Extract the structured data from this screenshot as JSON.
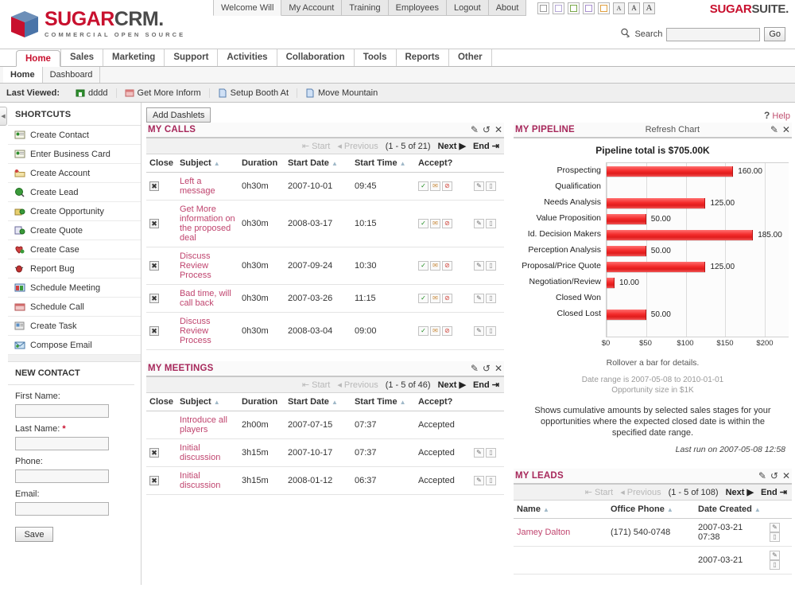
{
  "brand": {
    "name_primary": "SUGAR",
    "name_secondary": "CRM.",
    "tagline": "COMMERCIAL OPEN SOURCE",
    "suite_primary": "SUGAR",
    "suite_secondary": "SUITE.",
    "accent_color": "#c8102e",
    "dashlet_title_color": "#a7285b"
  },
  "utility_nav": [
    {
      "label": "Welcome Will",
      "active": true
    },
    {
      "label": "My Account",
      "active": false
    },
    {
      "label": "Training",
      "active": false
    },
    {
      "label": "Employees",
      "active": false
    },
    {
      "label": "Logout",
      "active": false
    },
    {
      "label": "About",
      "active": false
    }
  ],
  "theme_swatches": [
    {
      "name": "theme-swatch-gray",
      "color": "#9a9a9a"
    },
    {
      "name": "theme-swatch-lavender",
      "color": "#b6a8d8"
    },
    {
      "name": "theme-swatch-green",
      "color": "#7aa84a"
    },
    {
      "name": "theme-swatch-purple",
      "color": "#a98fd0"
    },
    {
      "name": "theme-swatch-orange",
      "color": "#e0a040"
    }
  ],
  "font_sizes": [
    {
      "label": "A",
      "size": "small"
    },
    {
      "label": "A",
      "size": "medium"
    },
    {
      "label": "A",
      "size": "large"
    }
  ],
  "search": {
    "label": "Search",
    "value": "",
    "placeholder": "",
    "button": "Go"
  },
  "module_tabs": [
    {
      "label": "Home",
      "active": true
    },
    {
      "label": "Sales",
      "active": false
    },
    {
      "label": "Marketing",
      "active": false
    },
    {
      "label": "Support",
      "active": false
    },
    {
      "label": "Activities",
      "active": false
    },
    {
      "label": "Collaboration",
      "active": false
    },
    {
      "label": "Tools",
      "active": false
    },
    {
      "label": "Reports",
      "active": false
    },
    {
      "label": "Other",
      "active": false
    }
  ],
  "sub_nav": [
    {
      "label": "Home",
      "active": true
    },
    {
      "label": "Dashboard",
      "active": false
    }
  ],
  "last_viewed": {
    "label": "Last Viewed:",
    "items": [
      {
        "label": "dddd",
        "icon": "account-icon"
      },
      {
        "label": "Get More Inform",
        "icon": "call-icon"
      },
      {
        "label": "Setup Booth At",
        "icon": "task-icon"
      },
      {
        "label": "Move Mountain",
        "icon": "task-icon"
      }
    ]
  },
  "sidebar": {
    "collapse_icon": "collapse-left-icon",
    "shortcuts_title": "SHORTCUTS",
    "shortcuts": [
      {
        "label": "Create Contact",
        "icon": "create-contact-icon"
      },
      {
        "label": "Enter Business Card",
        "icon": "business-card-icon"
      },
      {
        "label": "Create Account",
        "icon": "create-account-icon"
      },
      {
        "label": "Create Lead",
        "icon": "create-lead-icon"
      },
      {
        "label": "Create Opportunity",
        "icon": "create-opportunity-icon"
      },
      {
        "label": "Create Quote",
        "icon": "create-quote-icon"
      },
      {
        "label": "Create Case",
        "icon": "create-case-icon"
      },
      {
        "label": "Report Bug",
        "icon": "report-bug-icon"
      },
      {
        "label": "Schedule Meeting",
        "icon": "schedule-meeting-icon"
      },
      {
        "label": "Schedule Call",
        "icon": "schedule-call-icon"
      },
      {
        "label": "Create Task",
        "icon": "create-task-icon"
      },
      {
        "label": "Compose Email",
        "icon": "compose-email-icon"
      }
    ],
    "new_contact": {
      "title": "NEW CONTACT",
      "fields": [
        {
          "label": "First Name:",
          "value": "",
          "required": false
        },
        {
          "label": "Last Name:",
          "value": "",
          "required": true
        },
        {
          "label": "Phone:",
          "value": "",
          "required": false
        },
        {
          "label": "Email:",
          "value": "",
          "required": false
        }
      ],
      "save_label": "Save"
    }
  },
  "content": {
    "add_dashlets_label": "Add Dashlets",
    "help_label": "Help",
    "help_icon": "question-mark-icon"
  },
  "dashlet_actions": {
    "edit": "edit-pencil-icon",
    "refresh": "refresh-icon",
    "close": "close-x-icon"
  },
  "my_calls": {
    "title": "MY CALLS",
    "pager": {
      "start": "Start",
      "previous": "Previous",
      "count": "(1 - 5 of 21)",
      "next": "Next",
      "end": "End"
    },
    "columns": [
      "Close",
      "Subject",
      "Duration",
      "Start Date",
      "Start Time",
      "Accept?",
      ""
    ],
    "sortable": [
      false,
      true,
      false,
      true,
      true,
      false,
      false
    ],
    "rows": [
      {
        "close": true,
        "subject": "Left a message",
        "duration": "0h30m",
        "start_date": "2007-10-01",
        "start_time": "09:45",
        "overdue": false
      },
      {
        "close": true,
        "subject": "Get More information on the proposed deal",
        "duration": "0h30m",
        "start_date": "2008-03-17",
        "start_time": "10:15",
        "overdue": false
      },
      {
        "close": true,
        "subject": "Discuss Review Process",
        "duration": "0h30m",
        "start_date": "2007-09-24",
        "start_time": "10:30",
        "overdue": false
      },
      {
        "close": true,
        "subject": "Bad time, will call back",
        "duration": "0h30m",
        "start_date": "2007-03-26",
        "start_time": "11:15",
        "overdue": true
      },
      {
        "close": true,
        "subject": "Discuss Review Process",
        "duration": "0h30m",
        "start_date": "2008-03-04",
        "start_time": "09:00",
        "overdue": false
      }
    ]
  },
  "my_meetings": {
    "title": "MY MEETINGS",
    "pager": {
      "start": "Start",
      "previous": "Previous",
      "count": "(1 - 5 of 46)",
      "next": "Next",
      "end": "End"
    },
    "columns": [
      "Close",
      "Subject",
      "Duration",
      "Start Date",
      "Start Time",
      "Accept?",
      ""
    ],
    "rows": [
      {
        "close": false,
        "subject": "Introduce all players",
        "duration": "2h00m",
        "start_date": "2007-07-15",
        "start_time": "07:37",
        "accept": "Accepted",
        "actions": false
      },
      {
        "close": true,
        "subject": "Initial discussion",
        "duration": "3h15m",
        "start_date": "2007-10-17",
        "start_time": "07:37",
        "accept": "Accepted",
        "actions": true
      },
      {
        "close": true,
        "subject": "Initial discussion",
        "duration": "3h15m",
        "start_date": "2008-01-12",
        "start_time": "06:37",
        "accept": "Accepted",
        "actions": true
      }
    ]
  },
  "my_pipeline": {
    "title": "MY PIPELINE",
    "refresh_label": "Refresh Chart",
    "rollover_note": "Rollover a bar for details.",
    "date_range_note": "Date range is 2007-05-08 to 2010-01-01",
    "size_note": "Opportunity size in $1K",
    "description": "Shows cumulative amounts by selected sales stages for your opportunities where the expected closed date is within the specified date range.",
    "last_run": "Last run on 2007-05-08 12:58"
  },
  "my_leads": {
    "title": "MY LEADS",
    "pager": {
      "start": "Start",
      "previous": "Previous",
      "count": "(1 - 5 of 108)",
      "next": "Next",
      "end": "End"
    },
    "columns": [
      "Name",
      "Office Phone",
      "Date Created",
      ""
    ],
    "rows": [
      {
        "name": "Jamey Dalton",
        "phone": "(171) 540-0748",
        "created": "2007-03-21 07:38"
      },
      {
        "name": "",
        "phone": "",
        "created": "2007-03-21"
      }
    ]
  },
  "chart_data": {
    "type": "bar",
    "orientation": "horizontal",
    "title": "Pipeline total is $705.00K",
    "categories": [
      "Prospecting",
      "Qualification",
      "Needs Analysis",
      "Value Proposition",
      "Id. Decision Makers",
      "Perception Analysis",
      "Proposal/Price Quote",
      "Negotiation/Review",
      "Closed Won",
      "Closed Lost"
    ],
    "values": [
      160.0,
      0,
      125.0,
      50.0,
      185.0,
      50.0,
      125.0,
      10.0,
      0,
      50.0
    ],
    "value_labels": [
      "160.00",
      "",
      "125.00",
      "50.00",
      "185.00",
      "50.00",
      "125.00",
      "10.00",
      "",
      "50.00"
    ],
    "xlabel": "",
    "ylabel": "",
    "xlim": [
      0,
      230
    ],
    "xticks": [
      0,
      50,
      100,
      150,
      200
    ],
    "xtick_labels": [
      "$0",
      "$50",
      "$100",
      "$150",
      "$200"
    ],
    "grid": true,
    "legend": false,
    "bar_color": "#f32b2b",
    "total": "$705.00K",
    "units": "$1K"
  }
}
